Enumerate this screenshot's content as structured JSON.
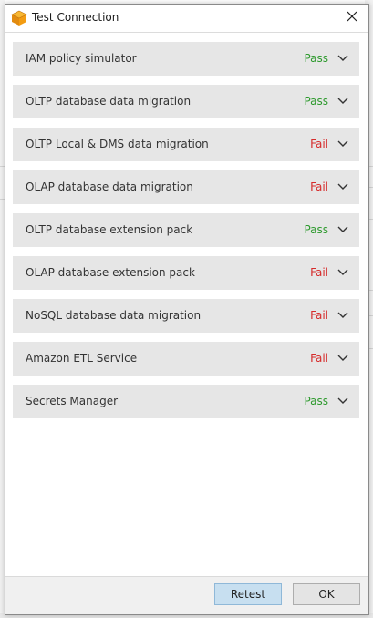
{
  "window": {
    "title": "Test Connection"
  },
  "checks": [
    {
      "label": "IAM policy simulator",
      "status": "Pass"
    },
    {
      "label": "OLTP database data migration",
      "status": "Pass"
    },
    {
      "label": "OLTP Local & DMS data migration",
      "status": "Fail"
    },
    {
      "label": "OLAP database data migration",
      "status": "Fail"
    },
    {
      "label": "OLTP database extension pack",
      "status": "Pass"
    },
    {
      "label": "OLAP database extension pack",
      "status": "Fail"
    },
    {
      "label": "NoSQL database data migration",
      "status": "Fail"
    },
    {
      "label": "Amazon ETL Service",
      "status": "Fail"
    },
    {
      "label": "Secrets Manager",
      "status": "Pass"
    }
  ],
  "buttons": {
    "retest": "Retest",
    "ok": "OK"
  },
  "colors": {
    "pass": "#2e9a2e",
    "fail": "#d62b2b",
    "row_bg": "#e6e6e6",
    "primary_button": "#c7dff0"
  },
  "icons": {
    "app": "aws-box-icon",
    "close": "close-icon",
    "expand": "chevron-down-icon"
  }
}
